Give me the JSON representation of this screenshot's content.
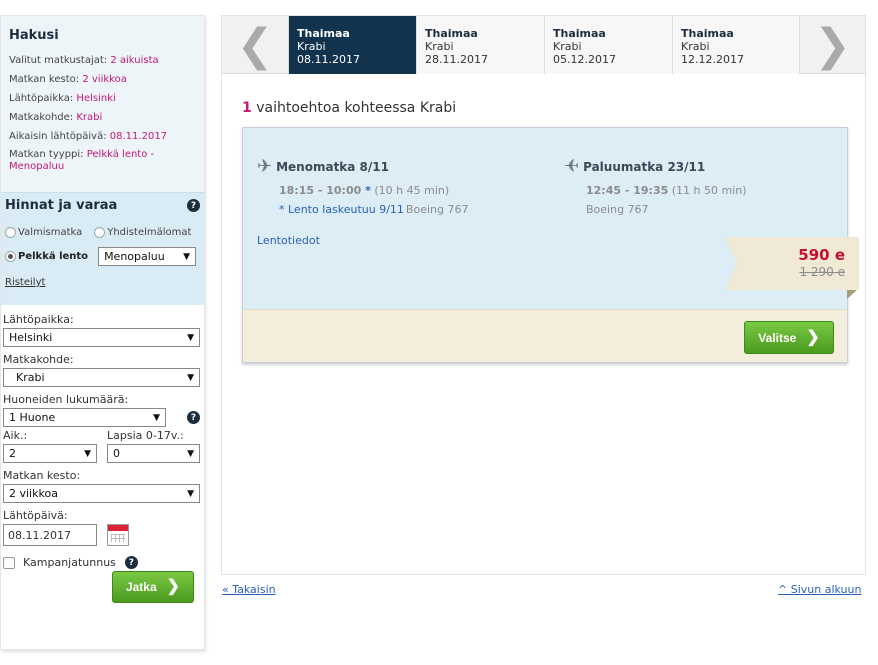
{
  "summary": {
    "title": "Hakusi",
    "rows": [
      {
        "label": "Valitut matkustajat: ",
        "value": "2 aikuista"
      },
      {
        "label": "Matkan kesto: ",
        "value": "2 viikkoa"
      },
      {
        "label": "Lähtöpaikka: ",
        "value": "Helsinki"
      },
      {
        "label": "Matkakohde: ",
        "value": "Krabi"
      },
      {
        "label": "Aikaisin lähtöpäivä: ",
        "value": "08.11.2017"
      },
      {
        "label": "Matkan tyyppi: ",
        "value": "Pelkkä lento - Menopaluu"
      }
    ]
  },
  "pricebox": {
    "title": "Hinnat ja varaa",
    "help_icon": "?",
    "radio_valmismatka": "Valmismatka",
    "radio_yhdistelmalomat": "Yhdistelmälomat",
    "radio_pelkka_lento": "Pelkkä lento",
    "trip_type_select": "Menopaluu",
    "risteilyt_link": "Risteilyt"
  },
  "form": {
    "lahtopaikka_label": "Lähtöpaikka:",
    "lahtopaikka_value": "Helsinki",
    "matkakohde_label": "Matkakohde:",
    "matkakohde_value": "Krabi",
    "huoneet_label": "Huoneiden lukumäärä:",
    "huoneet_value": "1 Huone",
    "aik_label": "Aik.:",
    "aik_value": "2",
    "lapsia_label": "Lapsia 0-17v.:",
    "lapsia_value": "0",
    "kesto_label": "Matkan kesto:",
    "kesto_value": "2 viikkoa",
    "lahtopaiva_label": "Lähtöpäivä:",
    "lahtopaiva_value": "08.11.2017",
    "kampanja_label": "Kampanjatunnus",
    "submit_label": "Jatka",
    "select_arrow": "▼"
  },
  "carousel": {
    "prev_icon": "❮",
    "next_icon": "❯",
    "tabs": [
      {
        "country": "Thaimaa",
        "city": "Krabi",
        "date": "08.11.2017",
        "active": true
      },
      {
        "country": "Thaimaa",
        "city": "Krabi",
        "date": "28.11.2017",
        "active": false
      },
      {
        "country": "Thaimaa",
        "city": "Krabi",
        "date": "05.12.2017",
        "active": false
      },
      {
        "country": "Thaimaa",
        "city": "Krabi",
        "date": "12.12.2017",
        "active": false
      }
    ]
  },
  "results": {
    "count": "1",
    "title_text": " vaihtoehtoa kohteessa Krabi"
  },
  "offer": {
    "outbound": {
      "title": "Menomatka 8/11",
      "times": "18:15 - 10:00",
      "star": " *",
      "duration": " (10 h 45 min)",
      "note": "* Lento laskeutuu 9/11",
      "aircraft": "Boeing 767"
    },
    "inbound": {
      "title": "Paluumatka 23/11",
      "times": "12:45 - 19:35",
      "duration": " (11 h 50 min)",
      "aircraft": "Boeing 767"
    },
    "details_link": "Lentotiedot",
    "price": "590 e",
    "old_price": "1 290 e",
    "select_label": "Valitse"
  },
  "footer": {
    "back_link": "« Takaisin",
    "top_link": "^ Sivun alkuun"
  },
  "colors": {
    "accent_pink": "#c2187a",
    "navy": "#12334d",
    "green": "#5fae2c",
    "price_red": "#c8102e",
    "link_blue": "#2a5fb8"
  }
}
